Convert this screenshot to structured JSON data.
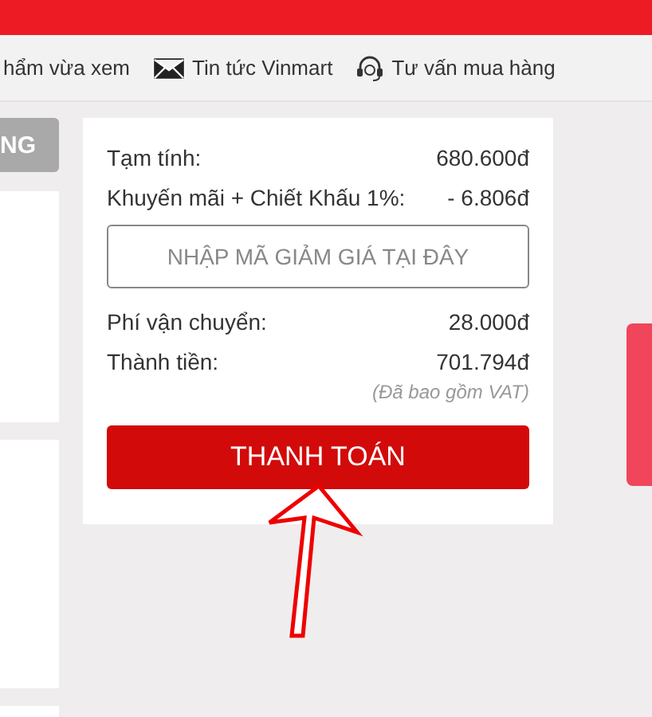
{
  "nav": [
    {
      "label": "hẩm vừa xem",
      "kind": "plain"
    },
    {
      "label": "Tin tức Vinmart",
      "kind": "news"
    },
    {
      "label": "Tư vấn mua hàng",
      "kind": "support"
    }
  ],
  "left_button": {
    "label": "NG"
  },
  "summary": {
    "rows": [
      {
        "label": "Tạm tính:",
        "value": "680.600đ"
      },
      {
        "label": "Khuyến mãi + Chiết Khấu 1%:",
        "value": "- 6.806đ"
      }
    ],
    "coupon": {
      "placeholder": "NHẬP MÃ GIẢM GIÁ TẠI ĐÂY"
    },
    "rows2": [
      {
        "label": "Phí vận chuyển:",
        "value": "28.000đ"
      },
      {
        "label": "Thành tiền:",
        "value": "701.794đ"
      }
    ],
    "vat_note": "(Đã bao gồm VAT)",
    "checkout_button": "THANH TOÁN"
  }
}
